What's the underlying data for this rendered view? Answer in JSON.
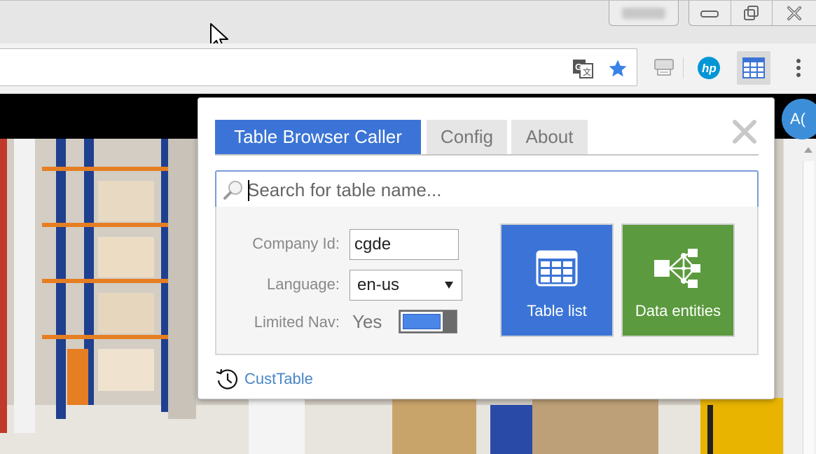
{
  "colors": {
    "accent": "#3b74d6",
    "tile_table_list": "#3b74d6",
    "tile_data_entities": "#5b9a3e",
    "link": "#4a86c8",
    "star": "#3b82e8",
    "hp": "#0096d6",
    "avatar": "#3d8ed8"
  },
  "window": {
    "controls": [
      {
        "name": "minimize-icon"
      },
      {
        "name": "restore-icon"
      },
      {
        "name": "close-icon"
      }
    ]
  },
  "toolbar": {
    "omnibox_icons": [
      "translate-icon",
      "bookmark-star-icon"
    ],
    "extensions": [
      "printer-extension-icon",
      "hp-extension-icon",
      "table-browser-extension-icon"
    ],
    "menu_icon": "more-vert-icon"
  },
  "page": {
    "avatar_text": "A("
  },
  "popup": {
    "tabs": [
      {
        "label": "Table Browser Caller",
        "active": true
      },
      {
        "label": "Config",
        "active": false
      },
      {
        "label": "About",
        "active": false
      }
    ],
    "close_icon": "close-x-icon",
    "search": {
      "placeholder": "Search for table name...",
      "value": "",
      "icon": "search-icon"
    },
    "form": {
      "company_label": "Company Id:",
      "company_value": "cgde",
      "language_label": "Language:",
      "language_value": "en-us",
      "limited_nav_label": "Limited Nav:",
      "limited_nav_value": "Yes",
      "limited_nav_on": true
    },
    "tiles": [
      {
        "label": "Table list",
        "icon": "table-grid-icon"
      },
      {
        "label": "Data entities",
        "icon": "data-entities-icon"
      }
    ],
    "history": {
      "icon": "history-icon",
      "link": "CustTable"
    }
  }
}
